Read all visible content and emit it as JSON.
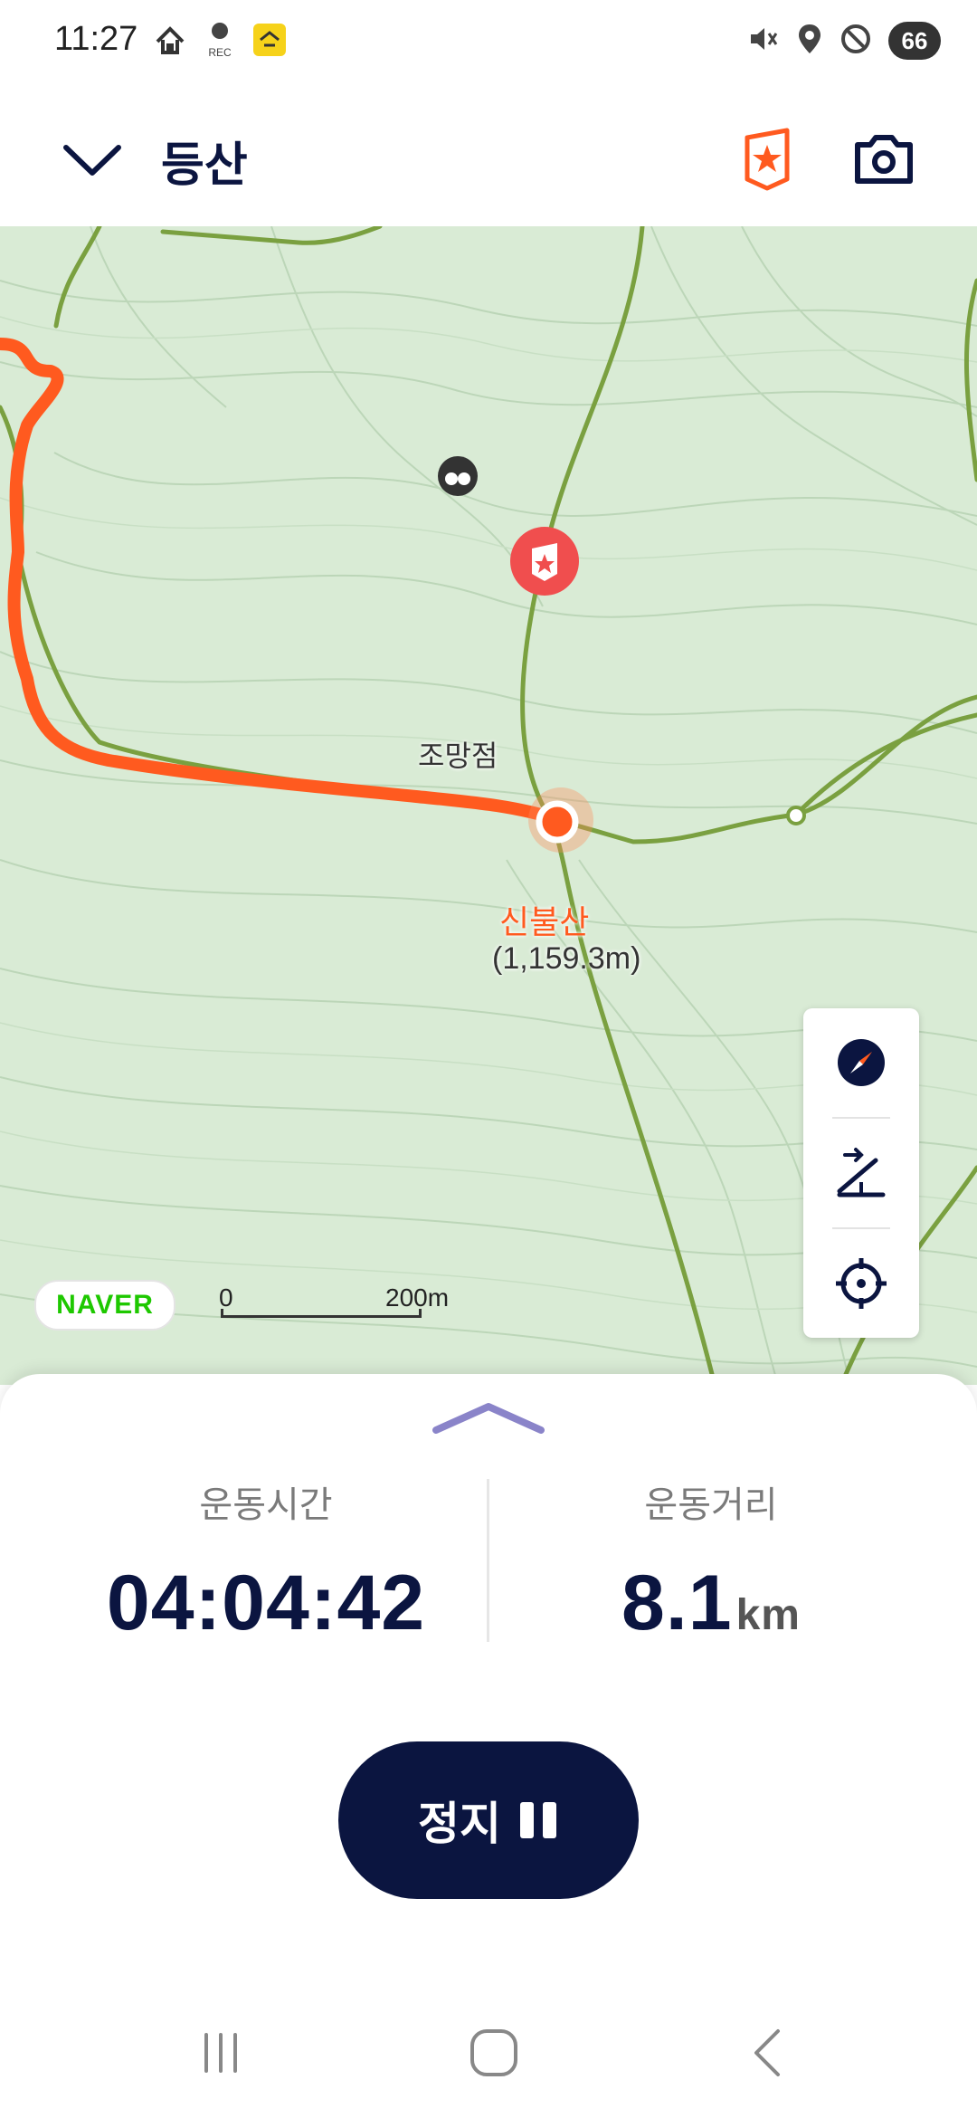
{
  "status_bar": {
    "time": "11:27",
    "battery": "66",
    "icons": [
      "home-upload-icon",
      "rec-indicator-icon",
      "app-badge-icon",
      "mute-icon",
      "location-icon",
      "do-not-disturb-icon",
      "battery-icon"
    ]
  },
  "header": {
    "title": "등산",
    "back_icon": "chevron-down-icon",
    "badge_icon": "mountain-badge-icon",
    "camera_icon": "camera-icon"
  },
  "map": {
    "viewpoint_label": "조망점",
    "peak_name": "신불산",
    "peak_elevation": "(1,159.3m)",
    "provider": "NAVER",
    "scale_start": "0",
    "scale_end": "200m",
    "route_color": "#ff5a1f",
    "trail_color": "#7aa040",
    "controls": [
      "compass-icon",
      "elevation-icon",
      "locate-icon"
    ]
  },
  "stats": {
    "time_label": "운동시간",
    "time_value": "04:04:42",
    "distance_label": "운동거리",
    "distance_value": "8.1",
    "distance_unit": "km"
  },
  "actions": {
    "stop_label": "정지"
  },
  "colors": {
    "primary": "#0b1540",
    "accent": "#ff5a1f",
    "handle": "#8a84c9"
  }
}
